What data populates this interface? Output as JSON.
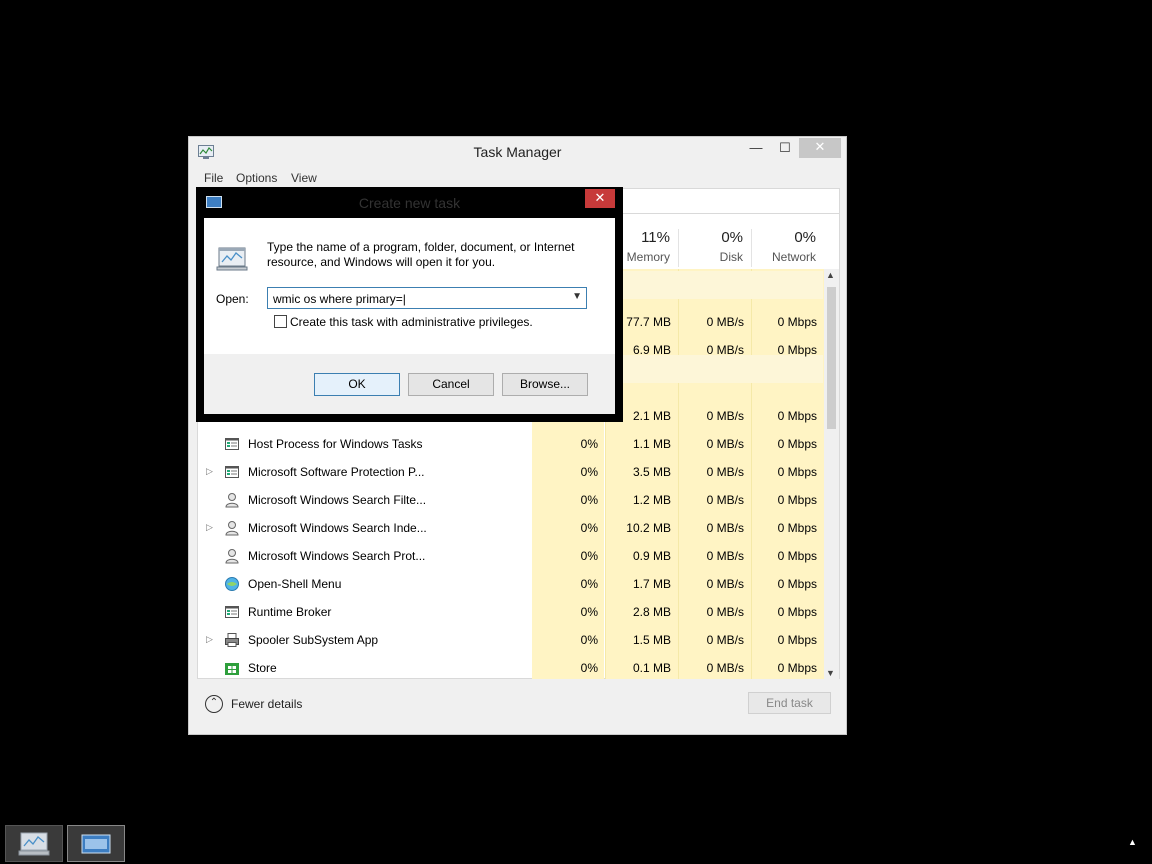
{
  "task_manager": {
    "title": "Task Manager",
    "caption": {
      "minimize": "—",
      "maximize": "☐",
      "close": "✕"
    },
    "menu": [
      "File",
      "Options",
      "View"
    ],
    "columns": [
      {
        "pct": "11%",
        "label": "Memory"
      },
      {
        "pct": "0%",
        "label": "Disk"
      },
      {
        "pct": "0%",
        "label": "Network"
      }
    ],
    "top_rows": [
      {
        "mem": "77.7 MB",
        "disk": "0 MB/s",
        "net": "0 Mbps"
      },
      {
        "mem": "6.9 MB",
        "disk": "0 MB/s",
        "net": "0 Mbps"
      },
      {
        "mem": "2.1 MB",
        "disk": "0 MB/s",
        "net": "0 Mbps"
      }
    ],
    "rows": [
      {
        "name": "Host Process for Windows Tasks",
        "expand": "",
        "icon": "window-icon",
        "cpu": "0%",
        "mem": "1.1 MB",
        "disk": "0 MB/s",
        "net": "0 Mbps"
      },
      {
        "name": "Microsoft Software Protection P...",
        "expand": "▷",
        "icon": "window-icon",
        "cpu": "0%",
        "mem": "3.5 MB",
        "disk": "0 MB/s",
        "net": "0 Mbps"
      },
      {
        "name": "Microsoft Windows Search Filte...",
        "expand": "",
        "icon": "user-icon",
        "cpu": "0%",
        "mem": "1.2 MB",
        "disk": "0 MB/s",
        "net": "0 Mbps"
      },
      {
        "name": "Microsoft Windows Search Inde...",
        "expand": "▷",
        "icon": "user-icon",
        "cpu": "0%",
        "mem": "10.2 MB",
        "disk": "0 MB/s",
        "net": "0 Mbps"
      },
      {
        "name": "Microsoft Windows Search Prot...",
        "expand": "",
        "icon": "user-icon",
        "cpu": "0%",
        "mem": "0.9 MB",
        "disk": "0 MB/s",
        "net": "0 Mbps"
      },
      {
        "name": "Open-Shell Menu",
        "expand": "",
        "icon": "globe-icon",
        "cpu": "0%",
        "mem": "1.7 MB",
        "disk": "0 MB/s",
        "net": "0 Mbps"
      },
      {
        "name": "Runtime Broker",
        "expand": "",
        "icon": "window-icon",
        "cpu": "0%",
        "mem": "2.8 MB",
        "disk": "0 MB/s",
        "net": "0 Mbps"
      },
      {
        "name": "Spooler SubSystem App",
        "expand": "▷",
        "icon": "printer-icon",
        "cpu": "0%",
        "mem": "1.5 MB",
        "disk": "0 MB/s",
        "net": "0 Mbps"
      },
      {
        "name": "Store",
        "expand": "",
        "icon": "store-icon",
        "cpu": "0%",
        "mem": "0.1 MB",
        "disk": "0 MB/s",
        "net": "0 Mbps"
      }
    ],
    "fewer_details": "Fewer details",
    "end_task": "End task",
    "colors": {
      "heat": "#fff4c4",
      "heat_light": "#fdf9e2"
    }
  },
  "dialog": {
    "title": "Create new task",
    "close": "✕",
    "description": "Type the name of a program, folder, document, or Internet resource, and Windows will open it for you.",
    "open_label": "Open:",
    "open_value": "wmic os where primary=|",
    "checkbox_label": "Create this task with administrative privileges.",
    "ok": "OK",
    "cancel": "Cancel",
    "browse": "Browse..."
  }
}
